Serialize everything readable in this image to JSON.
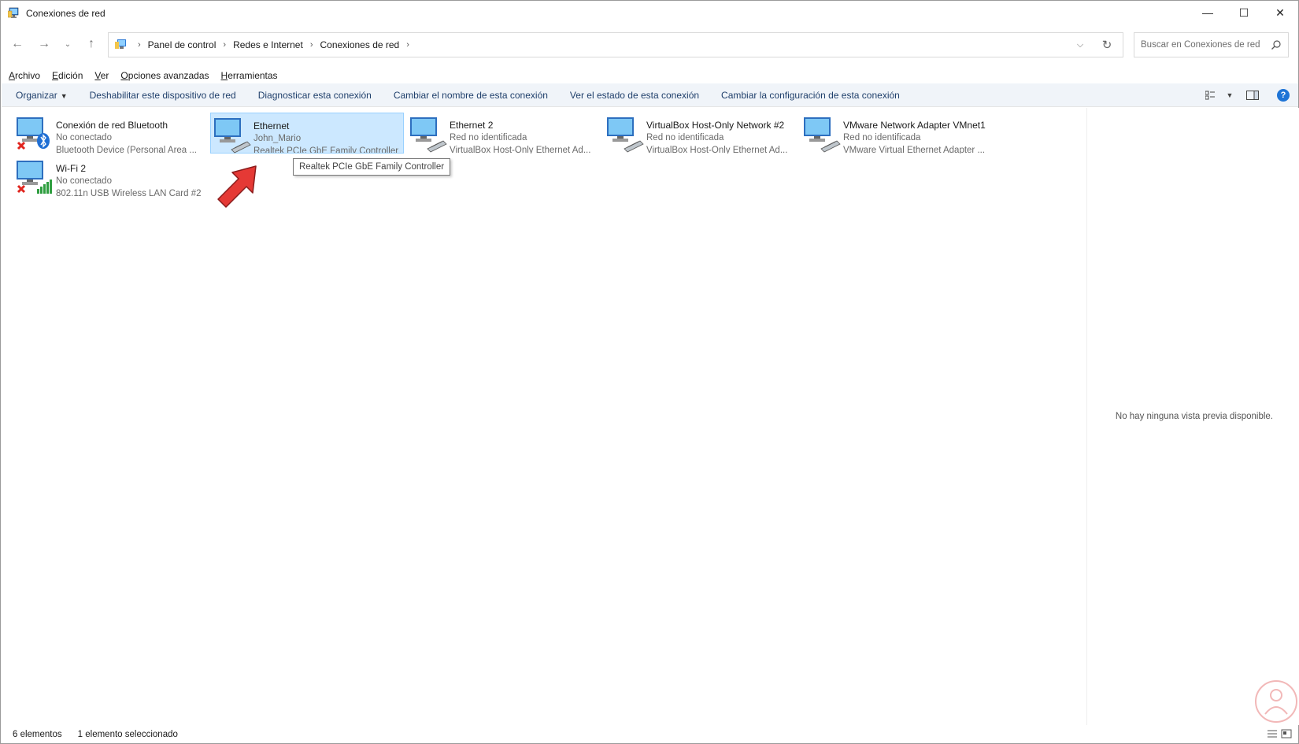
{
  "window": {
    "title": "Conexiones de red",
    "controls": {
      "minimize": "—",
      "maximize": "☐",
      "close": "✕"
    }
  },
  "address": {
    "crumbs": [
      "Panel de control",
      "Redes e Internet",
      "Conexiones de red"
    ],
    "search_placeholder": "Buscar en Conexiones de red"
  },
  "menu": {
    "items": [
      {
        "label": "Archivo"
      },
      {
        "label": "Edición"
      },
      {
        "label": "Ver"
      },
      {
        "label": "Opciones avanzadas"
      },
      {
        "label": "Herramientas"
      }
    ]
  },
  "commands": {
    "organize": "Organizar",
    "disable": "Deshabilitar este dispositivo de red",
    "diagnose": "Diagnosticar esta conexión",
    "rename": "Cambiar el nombre de esta conexión",
    "status": "Ver el estado de esta conexión",
    "config": "Cambiar la configuración de esta conexión",
    "help": "?"
  },
  "connections": [
    {
      "name": "Conexión de red Bluetooth",
      "status": "No conectado",
      "device": "Bluetooth Device (Personal Area ...",
      "icon": "bluetooth-network-icon",
      "disconnected": true,
      "selected": false
    },
    {
      "name": "Ethernet",
      "status": "John_Mario",
      "device": "Realtek PCIe GbE Family Controller",
      "icon": "ethernet-network-icon",
      "disconnected": false,
      "selected": true
    },
    {
      "name": "Ethernet 2",
      "status": "Red no identificada",
      "device": "VirtualBox Host-Only Ethernet Ad...",
      "icon": "ethernet-network-icon",
      "disconnected": false,
      "selected": false
    },
    {
      "name": "VirtualBox Host-Only Network #2",
      "status": "Red no identificada",
      "device": "VirtualBox Host-Only Ethernet Ad...",
      "icon": "ethernet-network-icon",
      "disconnected": false,
      "selected": false
    },
    {
      "name": "VMware Network Adapter VMnet1",
      "status": "Red no identificada",
      "device": "VMware Virtual Ethernet Adapter ...",
      "icon": "ethernet-network-icon",
      "disconnected": false,
      "selected": false
    },
    {
      "name": "Wi-Fi 2",
      "status": "No conectado",
      "device": "802.11n USB Wireless LAN Card #2",
      "icon": "wifi-network-icon",
      "disconnected": true,
      "selected": false
    }
  ],
  "tooltip": "Realtek PCIe GbE Family Controller",
  "preview": {
    "message": "No hay ninguna vista previa disponible."
  },
  "status_bar": {
    "count": "6 elementos",
    "selection": "1 elemento seleccionado"
  },
  "colors": {
    "selection_bg": "#cce8ff",
    "selection_border": "#99d1ff",
    "cmdbar_bg": "#f0f4f9",
    "link_text": "#1f3f6b",
    "arrow_red": "#e53935"
  }
}
